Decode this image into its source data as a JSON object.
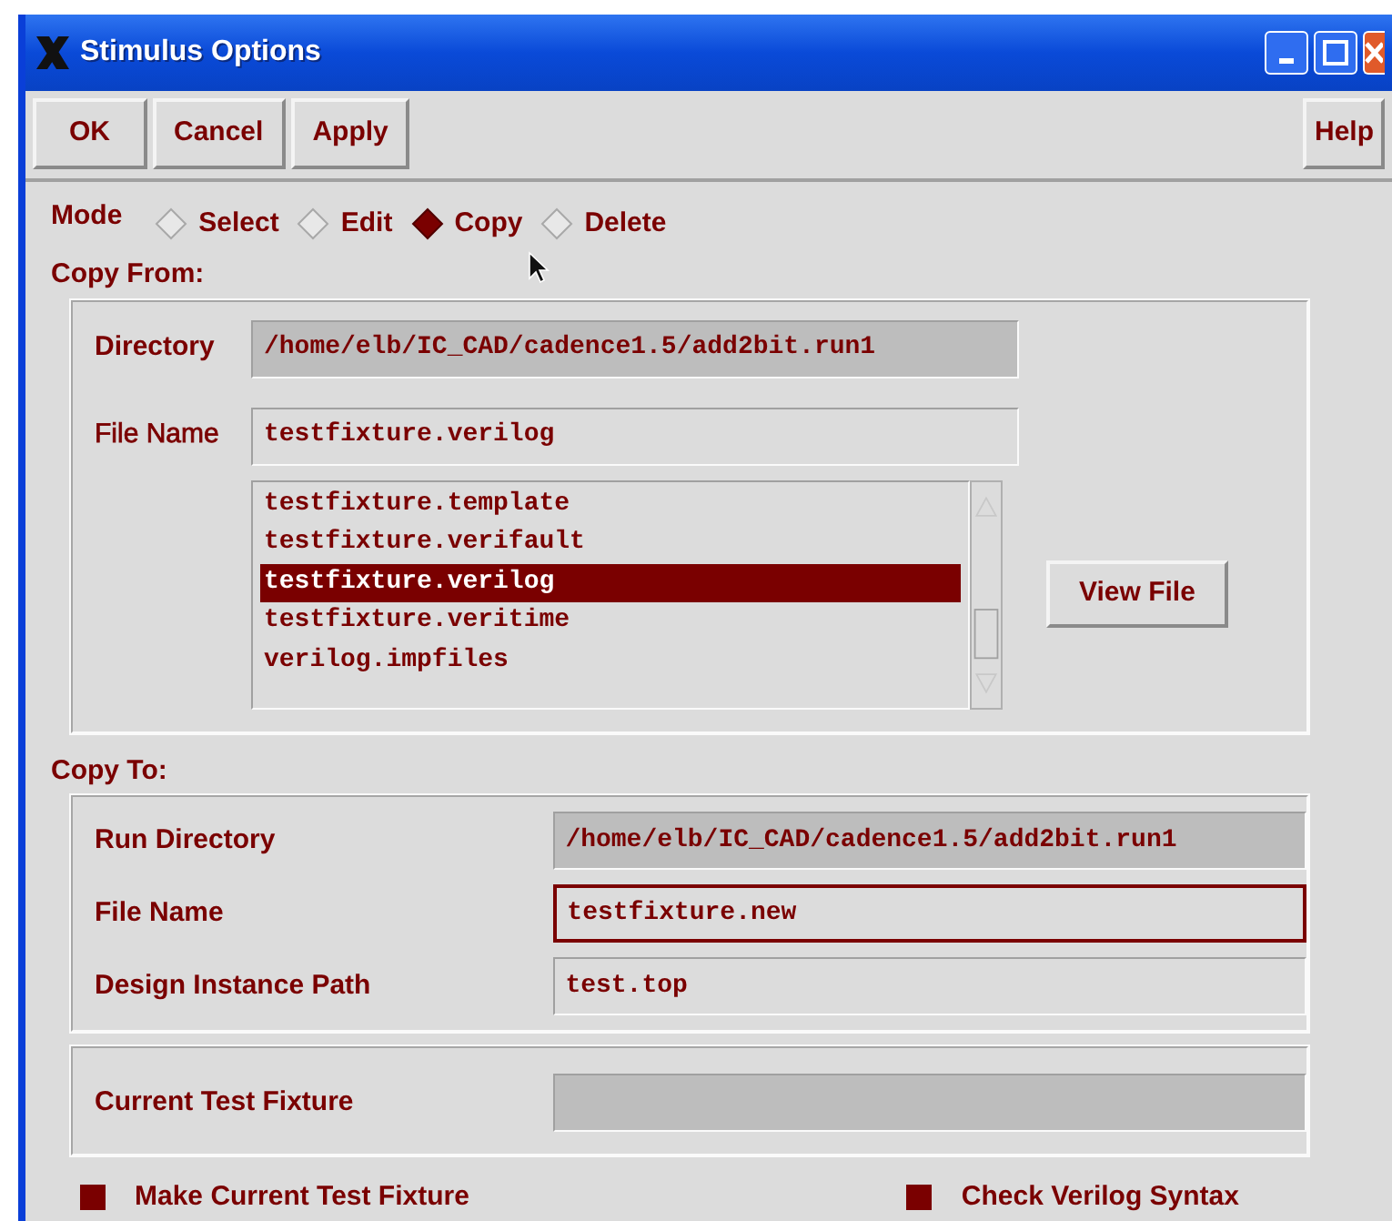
{
  "window": {
    "title": "Stimulus Options"
  },
  "buttons": [
    {
      "label": "OK"
    },
    {
      "label": "Cancel"
    },
    {
      "label": "Apply"
    }
  ],
  "help_button": {
    "label": "Help"
  },
  "mode": {
    "label": "Mode",
    "options": [
      {
        "label": "Select",
        "selected": false
      },
      {
        "label": "Edit",
        "selected": false
      },
      {
        "label": "Copy",
        "selected": true
      },
      {
        "label": "Delete",
        "selected": false
      }
    ]
  },
  "copy_from": {
    "title": "Copy From:",
    "directory_label": "Directory",
    "directory": "/home/elb/IC_CAD/cadence1.5/add2bit.run1",
    "file_name_label": "File Name",
    "file_name": "testfixture.verilog",
    "files": [
      {
        "name": "testfixture.template",
        "selected": false
      },
      {
        "name": "testfixture.verifault",
        "selected": false
      },
      {
        "name": "testfixture.verilog",
        "selected": true
      },
      {
        "name": "testfixture.veritime",
        "selected": false
      },
      {
        "name": "verilog.impfiles",
        "selected": false
      }
    ],
    "view_button": "View File"
  },
  "copy_to": {
    "title": "Copy To:",
    "rows": [
      {
        "label": "Run Directory",
        "value": "/home/elb/IC_CAD/cadence1.5/add2bit.run1",
        "kind": "readonly",
        "focused": false
      },
      {
        "label": "File Name",
        "value": "testfixture.new",
        "kind": "editable",
        "focused": true
      },
      {
        "label": "Design Instance Path",
        "value": "test.top",
        "kind": "editable",
        "focused": false
      }
    ]
  },
  "current": {
    "label": "Current Test Fixture"
  },
  "options": [
    {
      "label": "Make Current Test Fixture",
      "checked": true
    },
    {
      "label": "Check Verilog Syntax",
      "checked": true
    }
  ]
}
